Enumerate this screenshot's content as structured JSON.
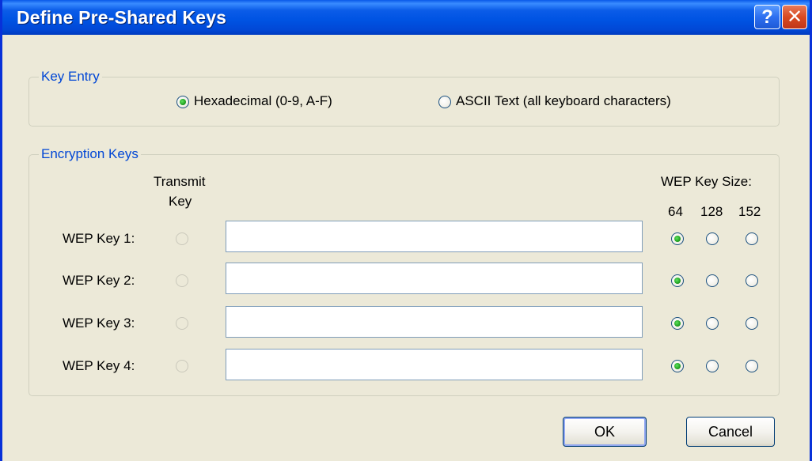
{
  "window": {
    "title": "Define Pre-Shared Keys",
    "help_label": "?",
    "close_label": "✕"
  },
  "key_entry": {
    "legend": "Key Entry",
    "options": [
      {
        "label": "Hexadecimal (0-9, A-F)",
        "checked": true
      },
      {
        "label": "ASCII Text (all keyboard characters)",
        "checked": false
      }
    ]
  },
  "encryption_keys": {
    "legend": "Encryption Keys",
    "transmit_header_line1": "Transmit",
    "transmit_header_line2": "Key",
    "size_header": "WEP Key Size:",
    "sizes": [
      "64",
      "128",
      "152"
    ],
    "keys": [
      {
        "label": "WEP Key 1:",
        "value": "",
        "selected_size": "64"
      },
      {
        "label": "WEP Key 2:",
        "value": "",
        "selected_size": "64"
      },
      {
        "label": "WEP Key 3:",
        "value": "",
        "selected_size": "64"
      },
      {
        "label": "WEP Key 4:",
        "value": "",
        "selected_size": "64"
      }
    ]
  },
  "buttons": {
    "ok": "OK",
    "cancel": "Cancel"
  },
  "colors": {
    "title_bar": "#0054e3",
    "legend_text": "#0046d5",
    "dialog_bg": "#ece9d8",
    "close_button": "#d84a21"
  }
}
